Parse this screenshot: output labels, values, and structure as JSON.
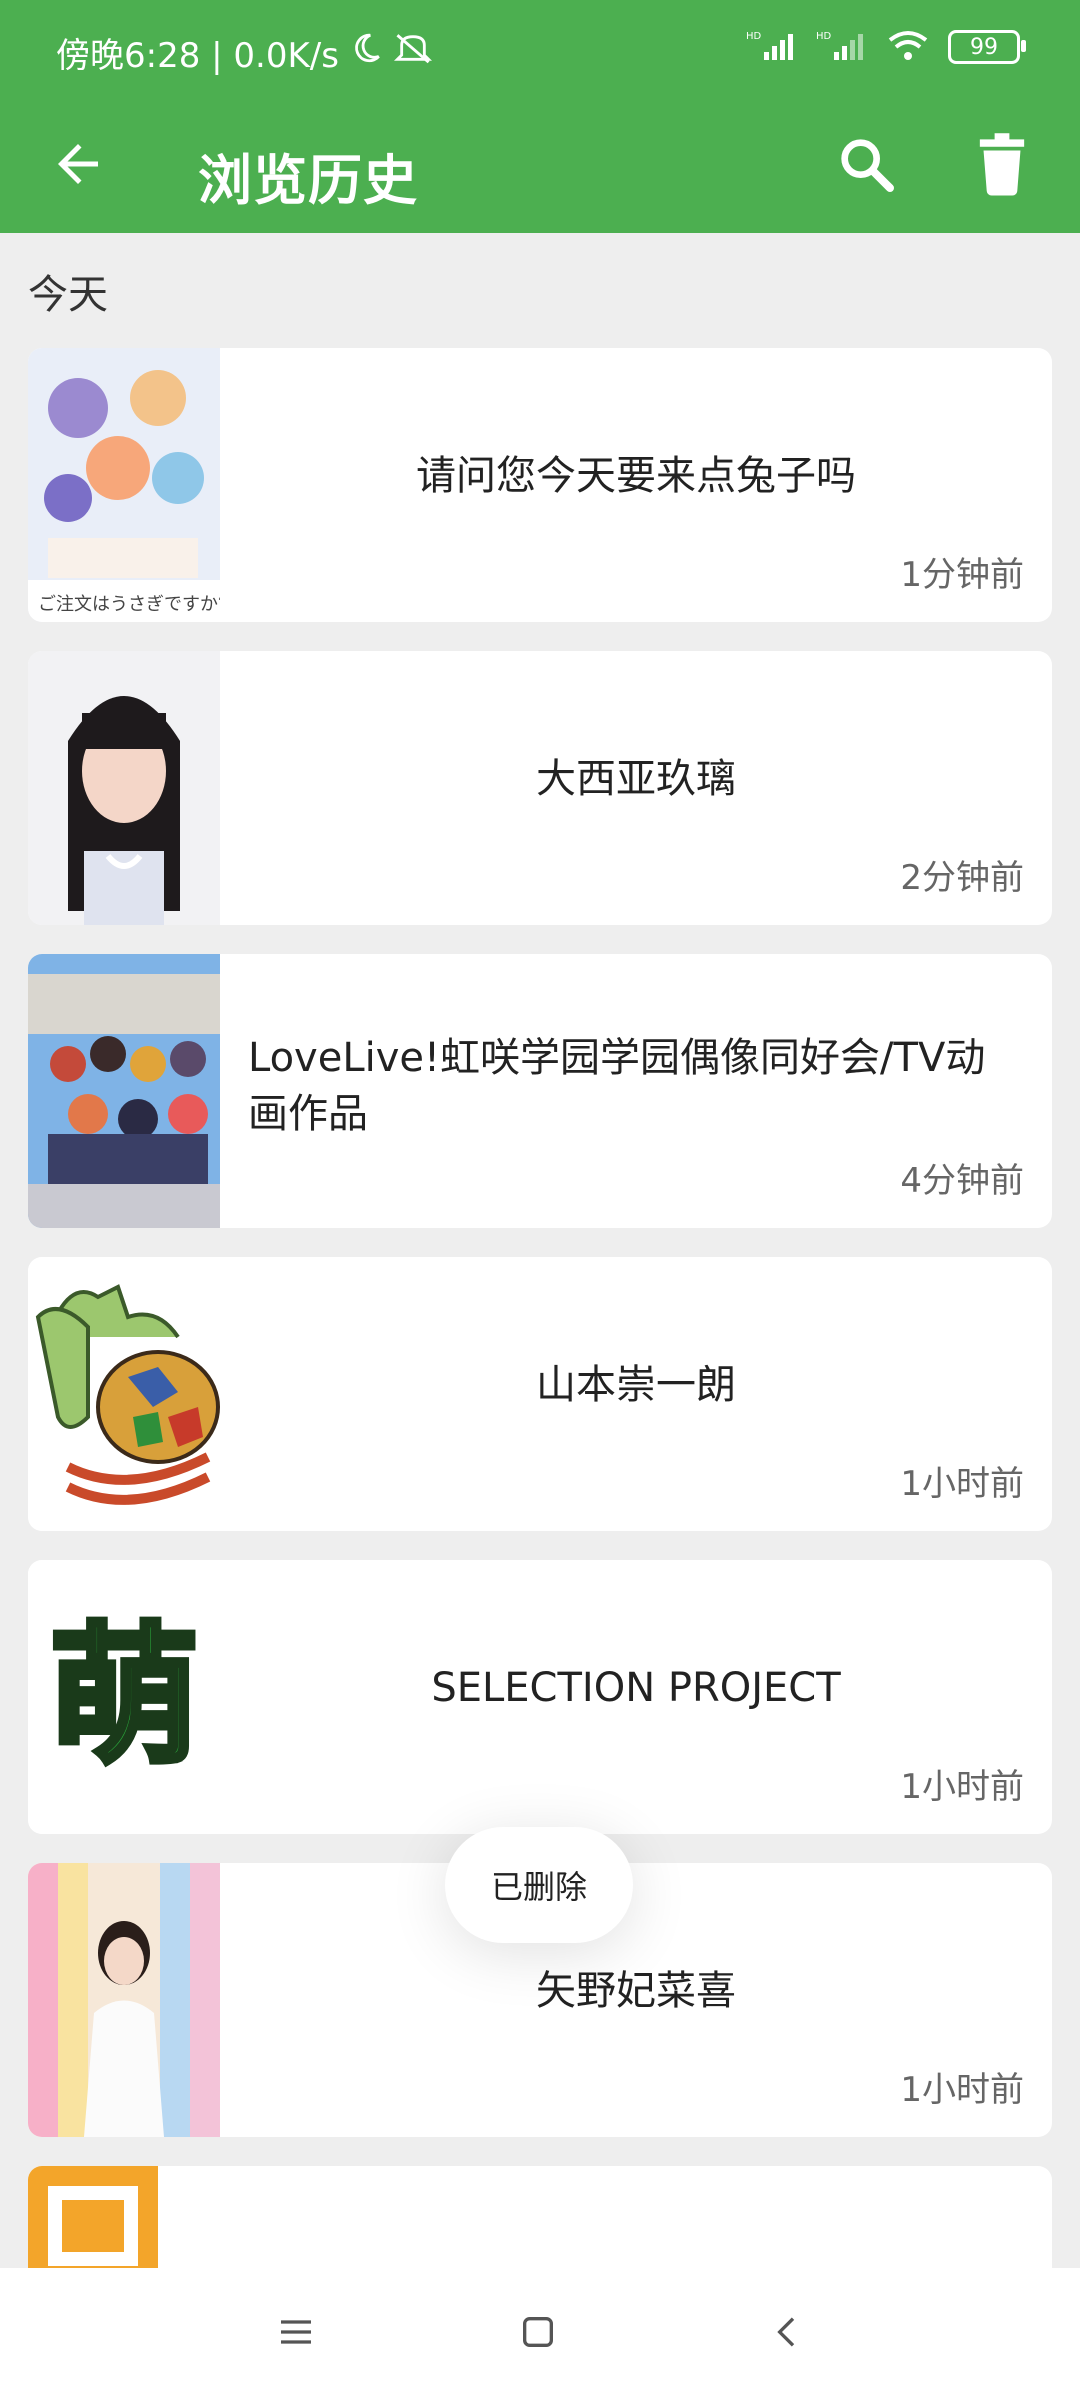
{
  "status_bar": {
    "time_speed": "傍晚6:28 | 0.0K/s",
    "battery": "99",
    "icons": [
      "moon-icon",
      "mute-icon",
      "hd-signal-icon",
      "hd-signal-icon",
      "wifi-icon",
      "battery-icon"
    ]
  },
  "app_bar": {
    "title": "浏览历史",
    "back_icon": "arrow-left-icon",
    "search_icon": "search-icon",
    "delete_icon": "trash-icon"
  },
  "colors": {
    "primary": "#4caf50",
    "background": "#eeeeee",
    "card": "#ffffff"
  },
  "section": {
    "label": "今天"
  },
  "items": [
    {
      "title": "请问您今天要来点兔子吗",
      "time": "1分钟前"
    },
    {
      "title": "大西亚玖璃",
      "time": "2分钟前"
    },
    {
      "title": "LoveLive!虹咲学园学园偶像同好会/TV动画作品",
      "time": "4分钟前"
    },
    {
      "title": "山本崇一朗",
      "time": "1小时前"
    },
    {
      "title": "SELECTION PROJECT",
      "time": "1小时前",
      "thumb_text": "萌"
    },
    {
      "title": "矢野妃菜喜",
      "time": "1小时前"
    }
  ],
  "toast": {
    "text": "已删除"
  },
  "nav": {
    "icons": [
      "menu-icon",
      "home-square-icon",
      "back-chevron-icon"
    ]
  }
}
